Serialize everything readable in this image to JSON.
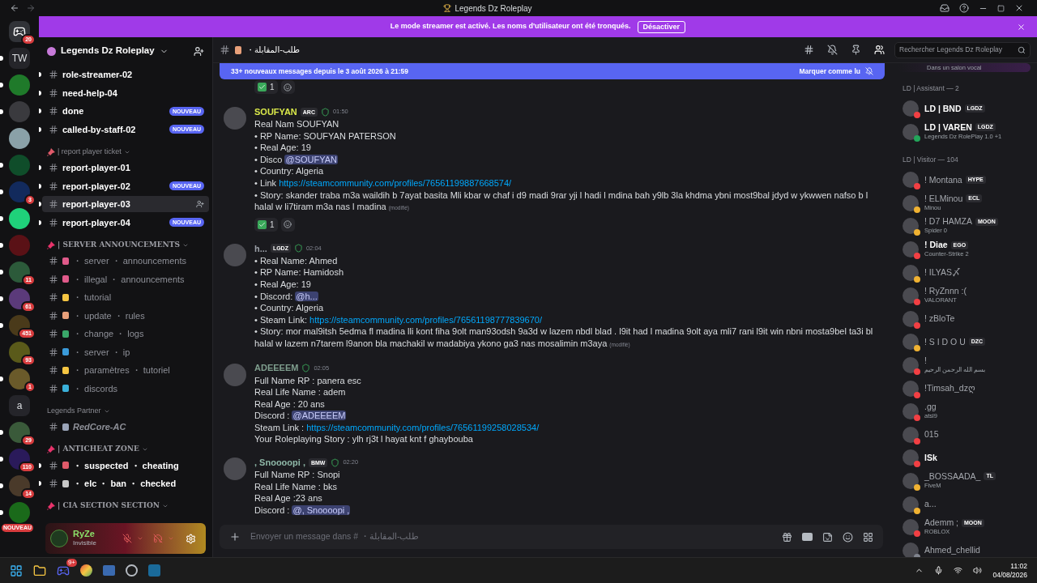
{
  "window": {
    "title": "Legends Dz Roleplay"
  },
  "streamer_banner": {
    "text": "Le mode streamer est activé. Les noms d'utilisateur ont été tronqués.",
    "button": "Désactiver"
  },
  "server_rail": [
    {
      "kind": "home",
      "badge": "20",
      "unread": false,
      "color": "#313338"
    },
    {
      "kind": "text",
      "label": "TW",
      "unread": true,
      "color": "#25252a"
    },
    {
      "kind": "avatar",
      "unread": true,
      "color": "#1f7a2a"
    },
    {
      "kind": "avatar",
      "unread": true,
      "color": "#3a3a3e"
    },
    {
      "kind": "avatar",
      "unread": false,
      "color": "#8aa1a8"
    },
    {
      "kind": "avatar",
      "unread": true,
      "color": "#0f4d2a"
    },
    {
      "kind": "avatar",
      "badge": "3",
      "unread": true,
      "color": "#122a5c"
    },
    {
      "kind": "avatar",
      "unread": true,
      "color": "#1fd17a"
    },
    {
      "kind": "avatar",
      "unread": true,
      "color": "#5a1116"
    },
    {
      "kind": "avatar",
      "badge": "11",
      "unread": true,
      "color": "#2c5a3a"
    },
    {
      "kind": "avatar",
      "badge": "61",
      "unread": true,
      "color": "#5b3a7a"
    },
    {
      "kind": "avatar",
      "badge": "451",
      "unread": true,
      "color": "#4a3a1a"
    },
    {
      "kind": "avatar",
      "badge": "93",
      "unread": false,
      "color": "#5a5a1a"
    },
    {
      "kind": "avatar",
      "badge": "1",
      "unread": true,
      "color": "#6a5a2a"
    },
    {
      "kind": "text",
      "label": "a",
      "unread": false,
      "color": "#25252a"
    },
    {
      "kind": "avatar",
      "badge": "29",
      "unread": true,
      "color": "#3a5a3a"
    },
    {
      "kind": "avatar",
      "badge": "110",
      "unread": true,
      "color": "#2a1a5a"
    },
    {
      "kind": "avatar",
      "badge": "14",
      "unread": true,
      "color": "#4a3a2a"
    },
    {
      "kind": "avatar",
      "badge": "NOUVEAU",
      "unread": true,
      "color": "#1a6a1a"
    }
  ],
  "sidebar": {
    "server_name": "Legends Dz Roleplay",
    "items": [
      {
        "kind": "channel",
        "name": "role-streamer-02",
        "unread": true,
        "selected": false,
        "italic": false
      },
      {
        "kind": "channel",
        "name": "need-help-04",
        "unread": true,
        "selected": false,
        "italic": false
      },
      {
        "kind": "channel",
        "name": "done",
        "unread": true,
        "selected": false,
        "italic": false,
        "badge": "NOUVEAU"
      },
      {
        "kind": "channel",
        "name": "called-by-staff-02",
        "unread": true,
        "selected": false,
        "italic": false,
        "badge": "NOUVEAU"
      },
      {
        "kind": "category",
        "name": "| report player ticket",
        "serif": false,
        "color": "#e05a6a"
      },
      {
        "kind": "channel",
        "name": "report-player-01",
        "unread": true,
        "selected": false,
        "italic": false
      },
      {
        "kind": "channel",
        "name": "report-player-02",
        "unread": true,
        "selected": false,
        "italic": false,
        "badge": "NOUVEAU"
      },
      {
        "kind": "channel",
        "name": "report-player-03",
        "unread": true,
        "selected": true,
        "italic": false
      },
      {
        "kind": "channel",
        "name": "report-player-04",
        "unread": true,
        "selected": false,
        "italic": false,
        "badge": "NOUVEAU"
      },
      {
        "kind": "category",
        "name": "| SERVER ANNOUNCEMENTS",
        "serif": true,
        "color": "#e8336b"
      },
      {
        "kind": "channel",
        "name": "・ server ・ announcements",
        "unread": false,
        "selected": false,
        "italic": false,
        "color": "#e05a8a"
      },
      {
        "kind": "channel",
        "name": "・ illegal ・ announcements",
        "unread": false,
        "selected": false,
        "italic": false,
        "color": "#e05a8a"
      },
      {
        "kind": "channel",
        "name": "・ tutorial",
        "unread": false,
        "selected": false,
        "italic": false,
        "color": "#f5c542"
      },
      {
        "kind": "channel",
        "name": "・ update ・ rules",
        "unread": false,
        "selected": false,
        "italic": false,
        "color": "#e8a07a"
      },
      {
        "kind": "channel",
        "name": "・ change ・ logs",
        "unread": false,
        "selected": false,
        "italic": false,
        "color": "#3aa86a"
      },
      {
        "kind": "channel",
        "name": "・ server ・ ip",
        "unread": false,
        "selected": false,
        "italic": false,
        "color": "#3a9ad9"
      },
      {
        "kind": "channel",
        "name": "・ paramètres ・ tutoriel",
        "unread": false,
        "selected": false,
        "italic": false,
        "color": "#f5c542"
      },
      {
        "kind": "channel",
        "name": "・ discords",
        "unread": false,
        "selected": false,
        "italic": false,
        "color": "#3ab0d9"
      },
      {
        "kind": "category",
        "name": "Legends Partner",
        "serif": false
      },
      {
        "kind": "channel",
        "name": "RedCore-AC",
        "unread": false,
        "selected": false,
        "italic": true,
        "color": "#9aa4b8"
      },
      {
        "kind": "category",
        "name": "| ANTICHEAT ZONE",
        "serif": true,
        "color": "#e8336b"
      },
      {
        "kind": "channel",
        "name": "・ suspected ・ cheating",
        "unread": true,
        "selected": false,
        "italic": false,
        "color": "#e05a6a"
      },
      {
        "kind": "channel",
        "name": "・ elc ・ ban ・ checked",
        "unread": true,
        "selected": false,
        "italic": false,
        "color": "#c8c8c8"
      },
      {
        "kind": "category",
        "name": "| CIA SECTION SECTION",
        "serif": true,
        "color": "#e8336b"
      }
    ]
  },
  "user_panel": {
    "name": "RyZe",
    "status": "Invisible"
  },
  "channel_header": {
    "name": "・طلب-المقابلة",
    "search_placeholder": "Rechercher Legends Dz Roleplay"
  },
  "new_messages_bar": {
    "text": "33+ nouveaux messages depuis le 3 août 2026 à 21:59",
    "action": "Marquer comme lu"
  },
  "top_reaction": {
    "count": "1"
  },
  "messages": [
    {
      "author": "SOUFYAN",
      "color": "#d9e84a",
      "tag": "ARC",
      "time": "01:50",
      "lines": [
        {
          "text": "Real Nam SOUFYAN"
        },
        {
          "text": "• RP Name: SOUFYAN PATERSON"
        },
        {
          "text": "• Real Age: 19"
        },
        {
          "text": "• Disco ",
          "mention": "@SOUFYAN"
        },
        {
          "text": "• Country: Algeria"
        },
        {
          "text": "• Link ",
          "link": "https://steamcommunity.com/profiles/76561199887668574/"
        },
        {
          "text": "• Story: skander traba m3a waildih b 7ayat basita Mli kbar w chaf i d9 madi 9rar yji l hadi l mdina bah y9lb 3la khdma ybni most9bal jdyd w ykwwen nafso b l halal w li7tiram m3a nas l madina",
          "edited": "(modifié)"
        }
      ],
      "reaction": {
        "count": "1"
      }
    },
    {
      "author": "h...",
      "color": "#9ba0a8",
      "tag": "LGDZ",
      "time": "02:04",
      "lines": [
        {
          "text": "• Real Name: Ahmed"
        },
        {
          "text": "• RP Name: Hamidosh"
        },
        {
          "text": "• Real Age: 19"
        },
        {
          "text": "• Discord: ",
          "mention": "@h..."
        },
        {
          "text": "• Country: Algeria"
        },
        {
          "text": "• Steam Link: ",
          "link": "https://steamcommunity.com/profiles/76561198777839670/"
        },
        {
          "text": "• Story: mor mal9itsh 5edma fl madina lli kont fiha 9olt man93odsh 9a3d w lazem nbdl blad . l9it had l madina 9olt aya mli7 rani l9it win nbni mosta9bel ta3i bl halal w lazem n7tarem l9anon bla machakil w madabiya ykono ga3 nas mosalimin m3aya",
          "edited": "(modifié)"
        }
      ]
    },
    {
      "author": "ADEEEEM",
      "color": "#7f9e8e",
      "time": "02:05",
      "lines": [
        {
          "text": "Full Name RP : panera esc"
        },
        {
          "text": "Real Life Name : adem"
        },
        {
          "text": "Real Age : 20 ans"
        },
        {
          "text": "Discord : ",
          "mention": "@ADEEEEM"
        },
        {
          "text": "Steam Link : ",
          "link": "https://steamcommunity.com/profiles/76561199258028534/"
        },
        {
          "text": "Your Roleplaying Story : ylh rj3t l hayat knt f ghaybouba"
        }
      ]
    },
    {
      "author": ", Snoooopi ,",
      "color": "#8fb8a8",
      "tag": "BMW",
      "time": "02:20",
      "lines": [
        {
          "text": "Full Name RP : Snopi"
        },
        {
          "text": "Real Life Name : bks"
        },
        {
          "text": "Real Age :23 ans"
        },
        {
          "text": "Discord : ",
          "mention": "@, Snoooopi ,"
        }
      ]
    }
  ],
  "composer": {
    "placeholder": "Envoyer un message dans # ・طلب-المقابلة"
  },
  "member_list": {
    "top_activity": "Dans un salon vocal",
    "groups": [
      {
        "title": "LD | Assistant — 2",
        "members": [
          {
            "name": "LD | BND",
            "tag": "LGDZ",
            "color": "#f23f43",
            "bold": true
          },
          {
            "name": "LD | VAREN",
            "tag": "LGDZ",
            "color": "#23a55a",
            "bold": true,
            "activity": "Legends Dz RolePlay 1.0 +1"
          }
        ]
      },
      {
        "title": "LD | Visitor — 104",
        "members": [
          {
            "name": "! Montana",
            "tag": "HYPE",
            "color": "#f23f43",
            "bold": false
          },
          {
            "name": "! ELMinou",
            "tag": "ECL",
            "color": "#f0b232",
            "bold": false,
            "activity": "Minou"
          },
          {
            "name": "! D7 HAMZA",
            "tag": "MOON",
            "color": "#f0b232",
            "bold": false,
            "activity": "Spider 0"
          },
          {
            "name": "! Diae",
            "tag": "EGO",
            "color": "#f23f43",
            "bold": true,
            "activity": "Counter-Strike 2"
          },
          {
            "name": "! ILYAS〆",
            "color": "#f0b232",
            "bold": false
          },
          {
            "name": "! RyZnnn :(",
            "color": "#f23f43",
            "bold": false,
            "activity": "VALORANT"
          },
          {
            "name": "! zBloTe",
            "color": "#f23f43",
            "bold": false
          },
          {
            "name": "! S I D O U",
            "tag": "DZC",
            "color": "#f0b232",
            "bold": false
          },
          {
            "name": "!",
            "color": "#f23f43",
            "bold": false,
            "activity": "بسم الله الرحمن الرحيم"
          },
          {
            "name": "!Timsah_dzღ",
            "color": "#f23f43",
            "bold": false
          },
          {
            "name": ".gg",
            "color": "#f23f43",
            "bold": false,
            "activity": "atsl9"
          },
          {
            "name": "015",
            "color": "#f23f43",
            "bold": false
          },
          {
            "name": "lSk",
            "color": "#f23f43",
            "bold": true
          },
          {
            "name": "_BOSSAADA_",
            "tag": "TL",
            "color": "#f0b232",
            "bold": false,
            "activity": "FiveM"
          },
          {
            "name": "a...",
            "color": "#f0b232",
            "bold": false
          },
          {
            "name": "Ademm ;",
            "tag": "MOON",
            "color": "#f23f43",
            "bold": false,
            "activity": "ROBLOX"
          },
          {
            "name": "Ahmed_chellid",
            "color": "#80848e",
            "bold": false
          }
        ]
      }
    ]
  },
  "taskbar": {
    "discord_badge": "9+",
    "time": "11:02",
    "date": "04/08/2026"
  }
}
